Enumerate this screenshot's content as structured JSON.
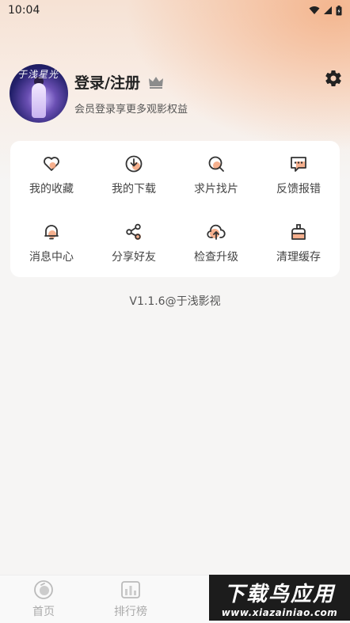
{
  "status_bar": {
    "time": "10:04"
  },
  "profile": {
    "login_title": "登录/注册",
    "subtitle": "会员登录享更多观影权益",
    "avatar_text": "于浅星光"
  },
  "menu": [
    {
      "label": "我的收藏",
      "icon": "heart-icon"
    },
    {
      "label": "我的下载",
      "icon": "download-icon"
    },
    {
      "label": "求片找片",
      "icon": "search-icon"
    },
    {
      "label": "反馈报错",
      "icon": "feedback-icon"
    },
    {
      "label": "消息中心",
      "icon": "bell-icon"
    },
    {
      "label": "分享好友",
      "icon": "share-icon"
    },
    {
      "label": "检查升级",
      "icon": "upgrade-icon"
    },
    {
      "label": "清理缓存",
      "icon": "clean-icon"
    }
  ],
  "version": "V1.1.6@于浅影视",
  "bottom_nav": [
    {
      "label": "首页",
      "icon": "home-icon"
    },
    {
      "label": "排行榜",
      "icon": "ranking-icon"
    }
  ],
  "watermark": {
    "main": "下载鸟应用",
    "url": "www.xiazainiao.com"
  },
  "colors": {
    "accent": "#f4a27a",
    "icon_stroke": "#333333"
  }
}
